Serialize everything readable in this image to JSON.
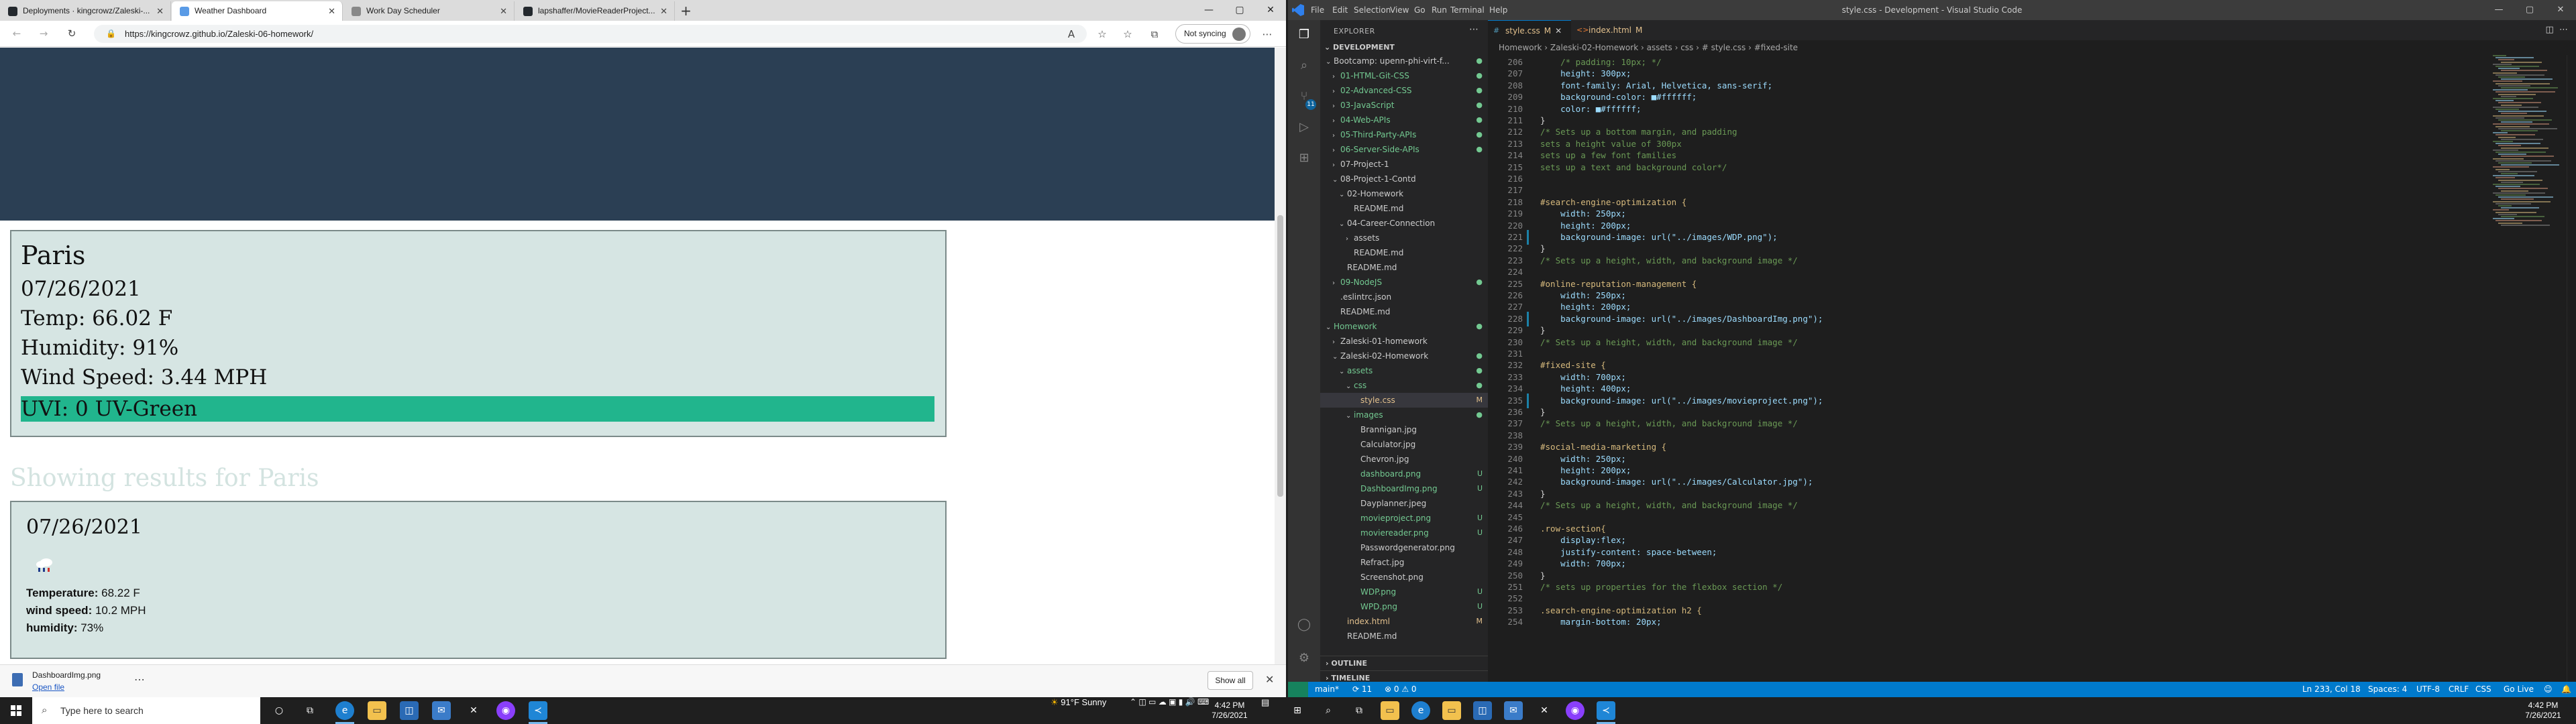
{
  "browser": {
    "tabs": [
      {
        "title": "Deployments · kingcrowz/Zaleski-...",
        "color": "#24292e"
      },
      {
        "title": "Weather Dashboard",
        "color": "#5a9be6"
      },
      {
        "title": "Work Day Scheduler",
        "color": "#888888"
      },
      {
        "title": "lapshaffer/MovieReaderProject...",
        "color": "#24292e"
      }
    ],
    "new_tab": "+",
    "url": "https://kingcrowz.github.io/Zaleski-06-homework/",
    "sync_label": "Not syncing",
    "page": {
      "current": {
        "city": "Paris",
        "date": "07/26/2021",
        "temp": "Temp: 66.02 F",
        "humidity": "Humidity: 91%",
        "wind": "Wind Speed: 3.44 MPH",
        "uvi": "UVI: 0 UV-Green",
        "uvi_color": "#21b58d"
      },
      "results_heading": "Showing results for Paris",
      "forecast": {
        "date": "07/26/2021",
        "temp_label": "Temperature:",
        "temp_value": " 68.22 F",
        "wind_label": "wind speed:",
        "wind_value": " 10.2 MPH",
        "humidity_label": "humidity:",
        "humidity_value": " 73%"
      }
    },
    "download": {
      "filename": "DashboardImg.png",
      "open_label": "Open file",
      "show_all": "Show all"
    }
  },
  "vscode": {
    "menu": [
      "File",
      "Edit",
      "Selection",
      "View",
      "Go",
      "Run",
      "Terminal",
      "Help"
    ],
    "window_title": "style.css - Development - Visual Studio Code",
    "explorer_title": "EXPLORER",
    "workspace": "DEVELOPMENT",
    "tree": [
      {
        "label": "Bootcamp: upenn-phi-virt-f...",
        "depth": 0,
        "arrow": "⌄",
        "color": "#cccccc",
        "status": "●",
        "status_color": "#73c991"
      },
      {
        "label": "01-HTML-Git-CSS",
        "depth": 1,
        "arrow": "›",
        "color": "#73c991",
        "status": "●",
        "status_color": "#73c991"
      },
      {
        "label": "02-Advanced-CSS",
        "depth": 1,
        "arrow": "›",
        "color": "#73c991",
        "status": "●",
        "status_color": "#73c991"
      },
      {
        "label": "03-JavaScript",
        "depth": 1,
        "arrow": "›",
        "color": "#73c991",
        "status": "●",
        "status_color": "#73c991"
      },
      {
        "label": "04-Web-APIs",
        "depth": 1,
        "arrow": "›",
        "color": "#73c991",
        "status": "●",
        "status_color": "#73c991"
      },
      {
        "label": "05-Third-Party-APIs",
        "depth": 1,
        "arrow": "›",
        "color": "#73c991",
        "status": "●",
        "status_color": "#73c991"
      },
      {
        "label": "06-Server-Side-APIs",
        "depth": 1,
        "arrow": "›",
        "color": "#73c991",
        "status": "●",
        "status_color": "#73c991"
      },
      {
        "label": "07-Project-1",
        "depth": 1,
        "arrow": "›",
        "color": "#cccccc",
        "status": "",
        "status_color": "#cccccc"
      },
      {
        "label": "08-Project-1-Contd",
        "depth": 1,
        "arrow": "⌄",
        "color": "#cccccc",
        "status": "",
        "status_color": "#cccccc"
      },
      {
        "label": "02-Homework",
        "depth": 2,
        "arrow": "⌄",
        "color": "#cccccc",
        "status": "",
        "status_color": "#cccccc"
      },
      {
        "label": "README.md",
        "depth": 3,
        "arrow": "",
        "color": "#cccccc",
        "status": "",
        "status_color": "#cccccc"
      },
      {
        "label": "04-Career-Connection",
        "depth": 2,
        "arrow": "⌄",
        "color": "#cccccc",
        "status": "",
        "status_color": "#cccccc"
      },
      {
        "label": "assets",
        "depth": 3,
        "arrow": "›",
        "color": "#cccccc",
        "status": "",
        "status_color": "#cccccc"
      },
      {
        "label": "README.md",
        "depth": 3,
        "arrow": "",
        "color": "#cccccc",
        "status": "",
        "status_color": "#cccccc"
      },
      {
        "label": "README.md",
        "depth": 2,
        "arrow": "",
        "color": "#cccccc",
        "status": "",
        "status_color": "#cccccc"
      },
      {
        "label": "09-NodeJS",
        "depth": 1,
        "arrow": "›",
        "color": "#73c991",
        "status": "●",
        "status_color": "#73c991"
      },
      {
        "label": ".eslintrc.json",
        "depth": 1,
        "arrow": "",
        "color": "#cccccc",
        "status": "",
        "status_color": "#cccccc"
      },
      {
        "label": "README.md",
        "depth": 1,
        "arrow": "",
        "color": "#cccccc",
        "status": "",
        "status_color": "#cccccc"
      },
      {
        "label": "Homework",
        "depth": 0,
        "arrow": "⌄",
        "color": "#73c991",
        "status": "●",
        "status_color": "#73c991"
      },
      {
        "label": "Zaleski-01-homework",
        "depth": 1,
        "arrow": "›",
        "color": "#cccccc",
        "status": "",
        "status_color": "#cccccc"
      },
      {
        "label": "Zaleski-02-Homework",
        "depth": 1,
        "arrow": "⌄",
        "color": "#cccccc",
        "status": "●",
        "status_color": "#73c991"
      },
      {
        "label": "assets",
        "depth": 2,
        "arrow": "⌄",
        "color": "#73c991",
        "status": "●",
        "status_color": "#73c991"
      },
      {
        "label": "css",
        "depth": 3,
        "arrow": "⌄",
        "color": "#73c991",
        "status": "●",
        "status_color": "#73c991"
      },
      {
        "label": "style.css",
        "depth": 4,
        "arrow": "",
        "color": "#e2c08d",
        "status": "M",
        "status_color": "#e2c08d",
        "selected": true
      },
      {
        "label": "images",
        "depth": 3,
        "arrow": "⌄",
        "color": "#73c991",
        "status": "●",
        "status_color": "#73c991"
      },
      {
        "label": "Brannigan.jpg",
        "depth": 4,
        "arrow": "",
        "color": "#cccccc",
        "status": "",
        "status_color": "#cccccc"
      },
      {
        "label": "Calculator.jpg",
        "depth": 4,
        "arrow": "",
        "color": "#cccccc",
        "status": "",
        "status_color": "#cccccc"
      },
      {
        "label": "Chevron.jpg",
        "depth": 4,
        "arrow": "",
        "color": "#cccccc",
        "status": "",
        "status_color": "#cccccc"
      },
      {
        "label": "dashboard.png",
        "depth": 4,
        "arrow": "",
        "color": "#73c991",
        "status": "U",
        "status_color": "#73c991"
      },
      {
        "label": "DashboardImg.png",
        "depth": 4,
        "arrow": "",
        "color": "#73c991",
        "status": "U",
        "status_color": "#73c991"
      },
      {
        "label": "Dayplanner.jpeg",
        "depth": 4,
        "arrow": "",
        "color": "#cccccc",
        "status": "",
        "status_color": "#cccccc"
      },
      {
        "label": "movieproject.png",
        "depth": 4,
        "arrow": "",
        "color": "#73c991",
        "status": "U",
        "status_color": "#73c991"
      },
      {
        "label": "moviereader.png",
        "depth": 4,
        "arrow": "",
        "color": "#73c991",
        "status": "U",
        "status_color": "#73c991"
      },
      {
        "label": "Passwordgenerator.png",
        "depth": 4,
        "arrow": "",
        "color": "#cccccc",
        "status": "",
        "status_color": "#cccccc"
      },
      {
        "label": "Refract.jpg",
        "depth": 4,
        "arrow": "",
        "color": "#cccccc",
        "status": "",
        "status_color": "#cccccc"
      },
      {
        "label": "Screenshot.png",
        "depth": 4,
        "arrow": "",
        "color": "#cccccc",
        "status": "",
        "status_color": "#cccccc"
      },
      {
        "label": "WDP.png",
        "depth": 4,
        "arrow": "",
        "color": "#73c991",
        "status": "U",
        "status_color": "#73c991"
      },
      {
        "label": "WPD.png",
        "depth": 4,
        "arrow": "",
        "color": "#73c991",
        "status": "U",
        "status_color": "#73c991"
      },
      {
        "label": "index.html",
        "depth": 2,
        "arrow": "",
        "color": "#e2c08d",
        "status": "M",
        "status_color": "#e2c08d"
      },
      {
        "label": "README.md",
        "depth": 2,
        "arrow": "",
        "color": "#cccccc",
        "status": "",
        "status_color": "#cccccc"
      }
    ],
    "outline": "OUTLINE",
    "timeline": "TIMELINE",
    "tabs": [
      {
        "label": "style.css",
        "mark": "M",
        "active": true
      },
      {
        "label": "index.html",
        "mark": "M",
        "active": false
      }
    ],
    "breadcrumb": "Homework  ›  Zaleski-02-Homework  ›  assets  ›  css  ›  # style.css  ›  #fixed-site",
    "code": [
      {
        "n": "206",
        "t": "    /* padding: 10px; */",
        "k": "cmt"
      },
      {
        "n": "207",
        "t": "    height: 300px;",
        "k": "decl"
      },
      {
        "n": "208",
        "t": "    font-family: Arial, Helvetica, sans-serif;",
        "k": "decl"
      },
      {
        "n": "209",
        "t": "    background-color: ■#ffffff;",
        "k": "decl"
      },
      {
        "n": "210",
        "t": "    color: ■#ffffff;",
        "k": "decl"
      },
      {
        "n": "211",
        "t": "}",
        "k": "pun"
      },
      {
        "n": "212",
        "t": "/* Sets up a bottom margin, and padding",
        "k": "cmt"
      },
      {
        "n": "213",
        "t": "sets a height value of 300px",
        "k": "cmt"
      },
      {
        "n": "214",
        "t": "sets up a few font families",
        "k": "cmt"
      },
      {
        "n": "215",
        "t": "sets up a text and background color*/",
        "k": "cmt"
      },
      {
        "n": "216",
        "t": "",
        "k": "pun"
      },
      {
        "n": "217",
        "t": "",
        "k": "pun"
      },
      {
        "n": "218",
        "t": "#search-engine-optimization {",
        "k": "sel"
      },
      {
        "n": "219",
        "t": "    width: 250px;",
        "k": "decl"
      },
      {
        "n": "220",
        "t": "    height: 200px;",
        "k": "decl"
      },
      {
        "n": "221",
        "t": "    background-image: url(\"../images/WDP.png\");",
        "k": "decl",
        "mod": true
      },
      {
        "n": "222",
        "t": "}",
        "k": "pun"
      },
      {
        "n": "223",
        "t": "/* Sets up a height, width, and background image */",
        "k": "cmt"
      },
      {
        "n": "224",
        "t": "",
        "k": "pun"
      },
      {
        "n": "225",
        "t": "#online-reputation-management {",
        "k": "sel"
      },
      {
        "n": "226",
        "t": "    width: 250px;",
        "k": "decl"
      },
      {
        "n": "227",
        "t": "    height: 200px;",
        "k": "decl"
      },
      {
        "n": "228",
        "t": "    background-image: url(\"../images/DashboardImg.png\");",
        "k": "decl",
        "mod": true
      },
      {
        "n": "229",
        "t": "}",
        "k": "pun"
      },
      {
        "n": "230",
        "t": "/* Sets up a height, width, and background image */",
        "k": "cmt"
      },
      {
        "n": "231",
        "t": "",
        "k": "pun"
      },
      {
        "n": "232",
        "t": "#fixed-site {",
        "k": "sel"
      },
      {
        "n": "233",
        "t": "    width: 700px;",
        "k": "decl"
      },
      {
        "n": "234",
        "t": "    height: 400px;",
        "k": "decl"
      },
      {
        "n": "235",
        "t": "    background-image: url(\"../images/movieproject.png\");",
        "k": "decl",
        "mod": true
      },
      {
        "n": "236",
        "t": "}",
        "k": "pun"
      },
      {
        "n": "237",
        "t": "/* Sets up a height, width, and background image */",
        "k": "cmt"
      },
      {
        "n": "238",
        "t": "",
        "k": "pun"
      },
      {
        "n": "239",
        "t": "#social-media-marketing {",
        "k": "sel"
      },
      {
        "n": "240",
        "t": "    width: 250px;",
        "k": "decl"
      },
      {
        "n": "241",
        "t": "    height: 200px;",
        "k": "decl"
      },
      {
        "n": "242",
        "t": "    background-image: url(\"../images/Calculator.jpg\");",
        "k": "decl"
      },
      {
        "n": "243",
        "t": "}",
        "k": "pun"
      },
      {
        "n": "244",
        "t": "/* Sets up a height, width, and background image */",
        "k": "cmt"
      },
      {
        "n": "245",
        "t": "",
        "k": "pun"
      },
      {
        "n": "246",
        "t": ".row-section{",
        "k": "sel"
      },
      {
        "n": "247",
        "t": "    display:flex;",
        "k": "decl"
      },
      {
        "n": "248",
        "t": "    justify-content: space-between;",
        "k": "decl"
      },
      {
        "n": "249",
        "t": "    width: 700px;",
        "k": "decl"
      },
      {
        "n": "250",
        "t": "}",
        "k": "pun"
      },
      {
        "n": "251",
        "t": "/* sets up properties for the flexbox section */",
        "k": "cmt"
      },
      {
        "n": "252",
        "t": "",
        "k": "pun"
      },
      {
        "n": "253",
        "t": ".search-engine-optimization h2 {",
        "k": "sel"
      },
      {
        "n": "254",
        "t": "    margin-bottom: 20px;",
        "k": "decl"
      }
    ],
    "status": {
      "branch": "main*",
      "sync": "⟳ 11",
      "problems": "⊗ 0 ⚠ 0",
      "position": "Ln 233, Col 18",
      "spaces": "Spaces: 4",
      "encoding": "UTF-8",
      "eol": "CRLF",
      "language": "CSS",
      "golive": "Go Live"
    }
  },
  "taskbar": {
    "search_placeholder": "Type here to search",
    "weather": "91°F  Sunny",
    "time": "4:42 PM",
    "date": "7/26/2021",
    "time2": "4:42 PM",
    "date2": "7/26/2021"
  }
}
